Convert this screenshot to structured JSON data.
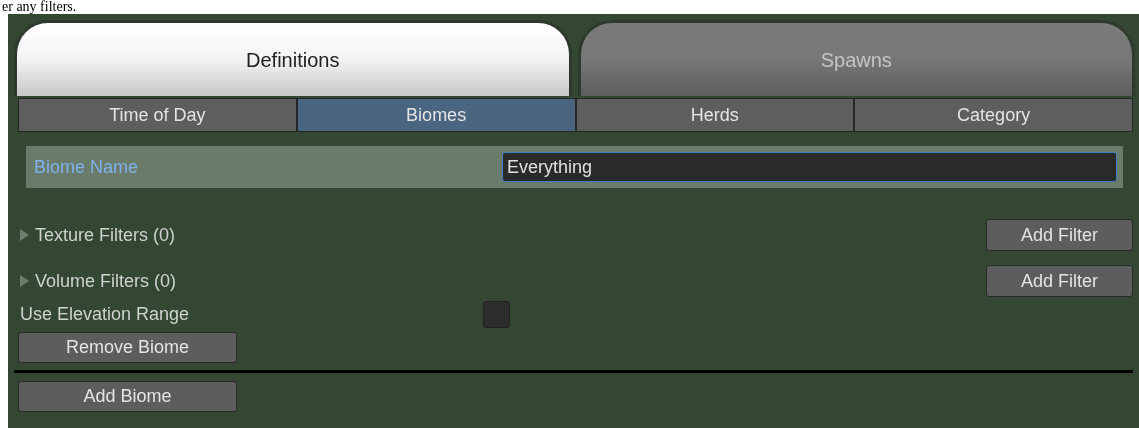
{
  "page_text": "er any filters.",
  "main_tabs": [
    {
      "label": "Definitions",
      "selected": true
    },
    {
      "label": "Spawns",
      "selected": false
    }
  ],
  "sub_tabs": [
    {
      "label": "Time of Day",
      "selected": false
    },
    {
      "label": "Biomes",
      "selected": true
    },
    {
      "label": "Herds",
      "selected": false
    },
    {
      "label": "Category",
      "selected": false
    }
  ],
  "biome_name": {
    "label": "Biome Name",
    "value": "Everything"
  },
  "filters": [
    {
      "label": "Texture Filters (0)",
      "expanded": false,
      "button": "Add Filter"
    },
    {
      "label": "Volume Filters (0)",
      "expanded": false,
      "button": "Add Filter"
    }
  ],
  "use_elevation_range": {
    "label": "Use Elevation Range",
    "checked": false
  },
  "remove_button": "Remove Biome",
  "add_button": "Add Biome"
}
